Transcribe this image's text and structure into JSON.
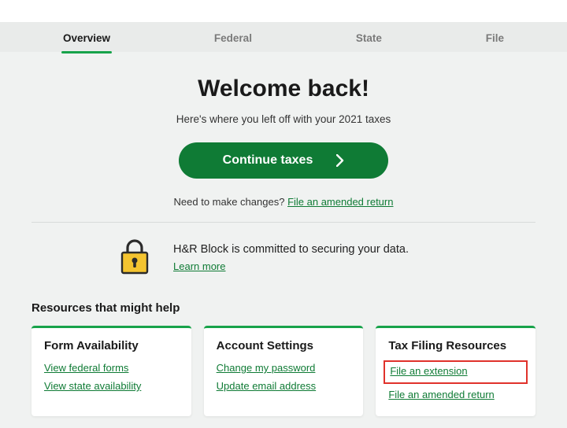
{
  "tabs": [
    "Overview",
    "Federal",
    "State",
    "File"
  ],
  "activeTab": 0,
  "welcome": {
    "title": "Welcome back!",
    "subtitle": "Here's where you left off with your 2021 taxes",
    "button": "Continue taxes",
    "changes_prefix": "Need to make changes? ",
    "changes_link": "File an amended return"
  },
  "security": {
    "message": "H&R Block is committed to securing your data.",
    "learn_more": "Learn more"
  },
  "resources_heading": "Resources that might help",
  "cards": [
    {
      "title": "Form Availability",
      "links": [
        "View federal forms",
        "View state availability"
      ]
    },
    {
      "title": "Account Settings",
      "links": [
        "Change my password",
        "Update email address"
      ]
    },
    {
      "title": "Tax Filing Resources",
      "links": [
        "File an extension",
        "File an amended return"
      ],
      "highlight_index": 0
    }
  ]
}
